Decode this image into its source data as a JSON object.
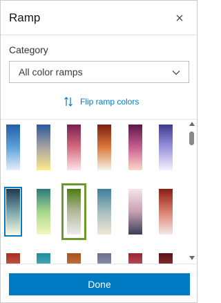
{
  "header": {
    "title": "Ramp"
  },
  "category": {
    "label": "Category",
    "selected": "All color ramps"
  },
  "flip": {
    "label": "Flip ramp colors"
  },
  "ramps": [
    [
      "#1f5fa8",
      "#5ea2d8",
      "#e6eefc"
    ],
    [
      "#2a58a0",
      "#a9a5a0",
      "#fde98c"
    ],
    [
      "#7a1f52",
      "#d46d7e",
      "#fde2e8"
    ],
    [
      "#7a1e10",
      "#dc7a3a",
      "#f6f2ea"
    ],
    [
      "#5a184a",
      "#c96090",
      "#fad8c8"
    ],
    [
      "#3f3a8e",
      "#9c95de",
      "#f4f2fb"
    ],
    [
      "#1d3752",
      "#7aa6aa",
      "#f6f9e4"
    ],
    [
      "#2c7c7d",
      "#a6d68a",
      "#f5f7ba"
    ],
    [
      "#4c7d12",
      "#b4b89b",
      "#ececec"
    ],
    [
      "#3c7e9c",
      "#a7bfbe",
      "#f0e6d6"
    ],
    [
      "#f6e6e8",
      "#c8a0b2",
      "#3a3f56"
    ],
    [
      "#8a1e14",
      "#d98070",
      "#f6e8e3"
    ],
    [
      "#a92c22",
      "#d07e6a",
      "#f4e1da"
    ],
    [
      "#1c8d9c",
      "#74c0c8",
      "#e6f4f4"
    ],
    [
      "#a8501d",
      "#d9905e",
      "#f6e6d6"
    ],
    [
      "#6a6e8c",
      "#a8aec4",
      "#eceef4"
    ],
    [
      "#9a2432",
      "#d0707c",
      "#f4e0e2"
    ],
    [
      "#5a1010",
      "#b05050",
      "#f0dcdc"
    ]
  ],
  "done": {
    "label": "Done"
  },
  "colors": {
    "accent": "#007ac2",
    "selected_green": "#6a9a2a"
  }
}
